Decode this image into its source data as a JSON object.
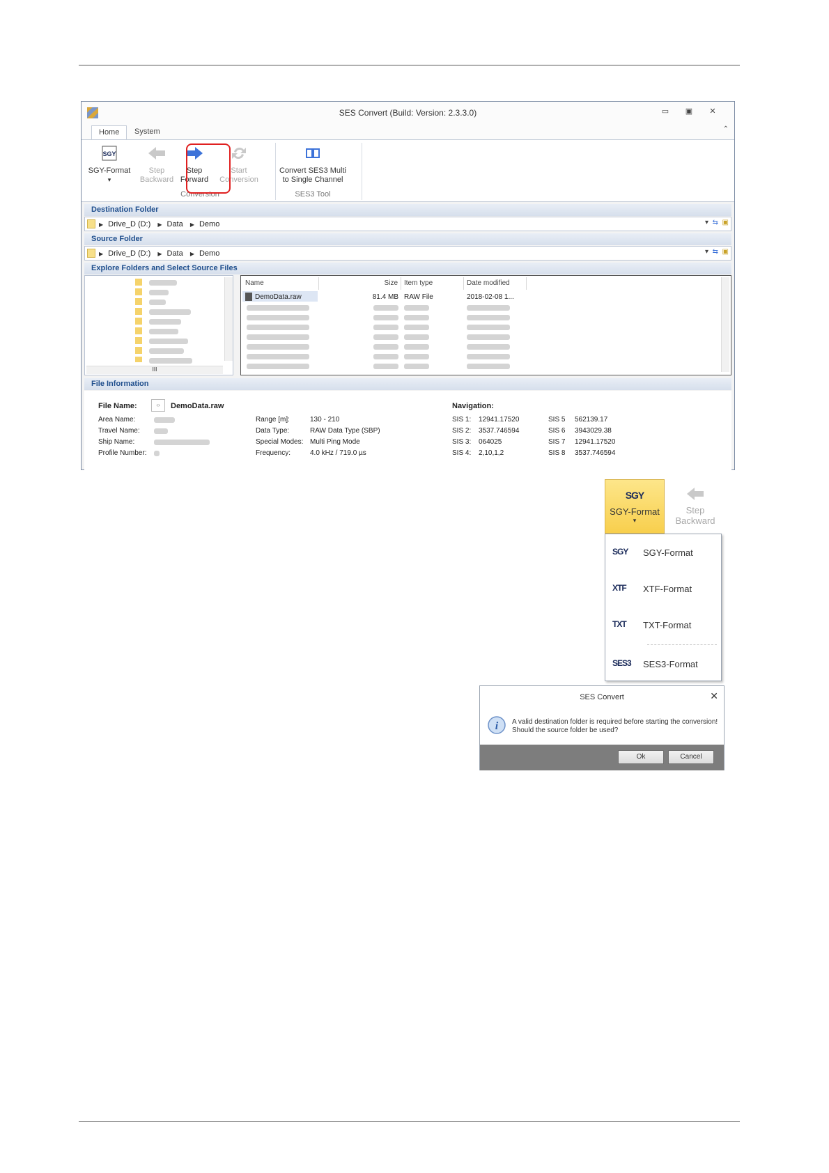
{
  "window": {
    "title": "SES Convert (Build: Version: 2.3.3.0)",
    "controls": [
      "▭",
      "▣",
      "✕"
    ]
  },
  "tabs": {
    "home": "Home",
    "system": "System"
  },
  "ribbon": {
    "sgy_format": "SGY-Format",
    "sgy_icon_text": "SGY",
    "step_backward_1": "Step",
    "step_backward_2": "Backward",
    "step_forward_1": "Step",
    "step_forward_2": "Forward",
    "start_conversion_1": "Start",
    "start_conversion_2": "Conversion",
    "convert_ses3_1": "Convert SES3 Multi",
    "convert_ses3_2": "to Single Channel",
    "group_conversion": "Conversion",
    "group_ses3_tool": "SES3 Tool",
    "dropdown_arrow": "▾"
  },
  "destination": {
    "header": "Destination Folder",
    "path": [
      "Drive_D (D:)",
      "Data",
      "Demo"
    ]
  },
  "source": {
    "header": "Source Folder",
    "path": [
      "Drive_D (D:)",
      "Data",
      "Demo"
    ]
  },
  "explorer": {
    "header": "Explore Folders and Select Source Files",
    "columns": {
      "name": "Name",
      "size": "Size",
      "item_type": "Item type",
      "date_modified": "Date modified"
    },
    "first_row": {
      "name": "DemoData.raw",
      "size": "81.4 MB",
      "type": "RAW File",
      "date": "2018-02-08 1..."
    },
    "tree_scroll_mark": "III"
  },
  "file_info": {
    "header": "File Information",
    "file_name_label": "File Name:",
    "file_name_value": "DemoData.raw",
    "area_name_label": "Area Name:",
    "travel_name_label": "Travel Name:",
    "ship_name_label": "Ship Name:",
    "profile_number_label": "Profile Number:",
    "range_label": "Range [m]:",
    "range_value": "130 - 210",
    "data_type_label": "Data Type:",
    "data_type_value": "RAW Data Type (SBP)",
    "special_modes_label": "Special Modes:",
    "special_modes_value": "Multi Ping Mode",
    "frequency_label": "Frequency:",
    "frequency_value": "4.0 kHz / 719.0 µs",
    "navigation_label": "Navigation:",
    "sis": [
      {
        "label": "SIS 1:",
        "value": "12941.17520"
      },
      {
        "label": "SIS 2:",
        "value": "3537.746594"
      },
      {
        "label": "SIS 3:",
        "value": "064025"
      },
      {
        "label": "SIS 4:",
        "value": "2,10,1,2"
      },
      {
        "label": "SIS 5",
        "value": "562139.17"
      },
      {
        "label": "SIS 6",
        "value": "3943029.38"
      },
      {
        "label": "SIS 7",
        "value": "12941.17520"
      },
      {
        "label": "SIS 8",
        "value": "3537.746594"
      }
    ]
  },
  "dropdown": {
    "button_label": "SGY-Format",
    "button_icon_text": "SGY",
    "step_backward_1": "Step",
    "step_backward_2": "Backward",
    "items": [
      {
        "icon": "SGY",
        "label": "SGY-Format"
      },
      {
        "icon": "XTF",
        "label": "XTF-Format"
      },
      {
        "icon": "TXT",
        "label": "TXT-Format"
      },
      {
        "icon": "SES3",
        "label": "SES3-Format"
      }
    ]
  },
  "dialog": {
    "title": "SES Convert",
    "message_1": "A valid destination folder is required before starting the conversion!",
    "message_2": "Should the source folder be used?",
    "ok": "Ok",
    "cancel": "Cancel"
  },
  "colors": {
    "accent_blue": "#3d73d9",
    "highlight_red": "#e02020",
    "header_text": "#1f4e8c"
  }
}
